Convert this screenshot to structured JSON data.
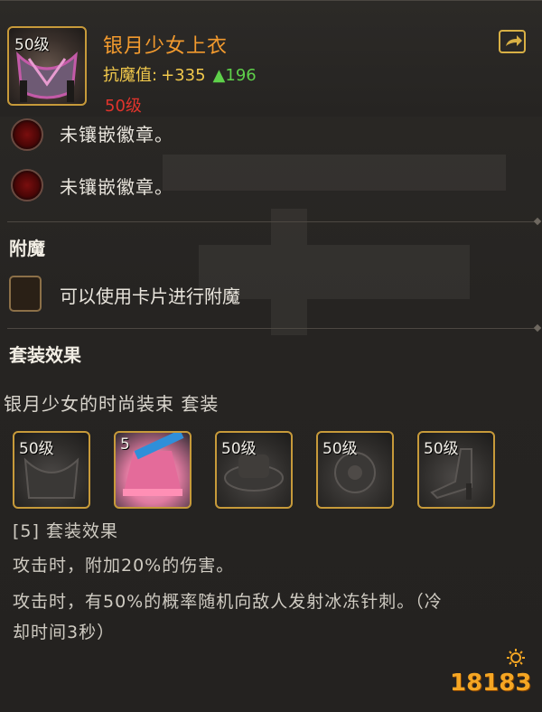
{
  "item": {
    "level_badge": "50级",
    "name": "银月少女上衣",
    "stat_label": "抗魔值:",
    "stat_value": "+335",
    "stat_up": "▲196",
    "required_level": "50级",
    "share_icon": "share-icon"
  },
  "sockets": [
    {
      "text": "未镶嵌徽章。"
    },
    {
      "text": "未镶嵌徽章。"
    }
  ],
  "enchant": {
    "title": "附魔",
    "card_text": "可以使用卡片进行附魔"
  },
  "set_effects": {
    "title": "套装效果",
    "set_name": "银月少女的时尚装束 套装",
    "pieces": [
      {
        "level": "50级",
        "active": false
      },
      {
        "level": "5",
        "active": true
      },
      {
        "level": "50级",
        "active": false
      },
      {
        "level": "50级",
        "active": false
      },
      {
        "level": "50级",
        "active": false
      }
    ],
    "lines": [
      "[5] 套装效果",
      "攻击时，附加20%的伤害。",
      "攻击时，有50%的概率随机向敌人发射冰冻针刺。（冷",
      "却时间3秒）"
    ]
  },
  "watermark": "18183",
  "colors": {
    "name": "#f29a2e",
    "stat": "#f2c94c",
    "stat_up": "#5ed04a",
    "required_level": "#e0342c",
    "frame_gold": "#c79a3a"
  }
}
